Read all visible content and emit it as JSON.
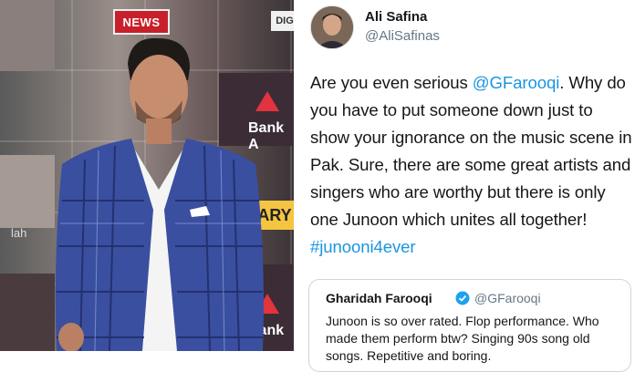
{
  "photo": {
    "badge_news": "NEWS",
    "badge_dig": "DIG",
    "bank_label_top": "Bank A",
    "bank_label_bottom": "Bank A",
    "ary_label": "ARY",
    "lah_label": "lah"
  },
  "tweet": {
    "author_name": "Ali Safina",
    "author_handle": "@AliSafinas",
    "text_prefix": "Are you even serious ",
    "mention": "@GFarooqi",
    "text_body": ". Why do you have to put someone down just to show your ignorance on the music scene in Pak. Sure, there are some great artists and singers who are worthy but there is only one Junoon which unites all together! ",
    "hashtag": "#junooni4ever"
  },
  "quoted_tweet": {
    "author_name": "Gharidah Farooqi",
    "author_handle": "@GFarooqi",
    "verified_icon": "verified-badge-icon",
    "text": "Junoon is so over rated. Flop performance. Who made them perform btw? Singing 90s song old songs. Repetitive and boring."
  },
  "colors": {
    "link": "#1b95e0",
    "text": "#14171a",
    "muted": "#657786",
    "news_red": "#c8202a"
  }
}
